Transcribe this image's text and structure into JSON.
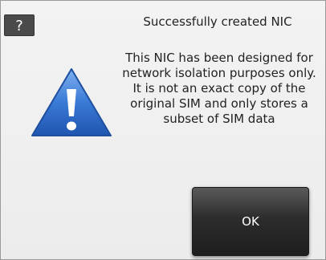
{
  "dialog": {
    "help_label": "?",
    "title": "Successfully created NIC",
    "message_lines": [
      "This NIC has been designed for",
      "network isolation purposes only.",
      "It is not an exact copy of the",
      "original SIM and only stores a",
      "subset of SIM data"
    ],
    "icon": "warning-icon",
    "ok_label": "OK"
  },
  "colors": {
    "background": "#f0f0f0",
    "button_dark": "#2c2c2c",
    "warning_blue": "#2f6fcf"
  }
}
